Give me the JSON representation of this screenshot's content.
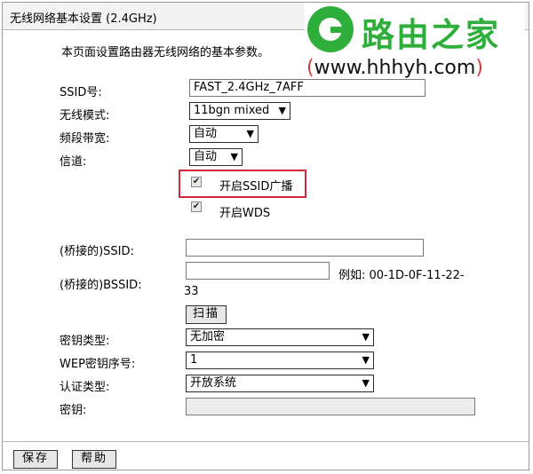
{
  "page": {
    "title": "无线网络基本设置 (2.4GHz)",
    "intro": "本页面设置路由器无线网络的基本参数。"
  },
  "watermark": {
    "name": "路由之家",
    "url_prefix": "(",
    "url": "www.hhhyh.com",
    "url_suffix": ")",
    "brand_color": "#2eae3a"
  },
  "form": {
    "ssid": {
      "label": "SSID号:",
      "value": "FAST_2.4GHz_7AFF"
    },
    "mode": {
      "label": "无线模式:",
      "value": "11bgn mixed"
    },
    "bandwidth": {
      "label": "频段带宽:",
      "value": "自动"
    },
    "channel": {
      "label": "信道:",
      "value": "自动"
    },
    "ssid_broadcast": {
      "label": "开启SSID广播",
      "checked": true
    },
    "wds": {
      "label": "开启WDS",
      "checked": true
    },
    "bridge_ssid": {
      "label": "(桥接的)SSID:",
      "value": ""
    },
    "bridge_bssid": {
      "label": "(桥接的)BSSID:",
      "value": "",
      "example": "例如: 00-1D-0F-11-22-",
      "example_cont": "33"
    },
    "scan_button": "扫描",
    "key_type": {
      "label": "密钥类型:",
      "value": "无加密"
    },
    "wep_index": {
      "label": "WEP密钥序号:",
      "value": "1"
    },
    "auth_type": {
      "label": "认证类型:",
      "value": "开放系统"
    },
    "key": {
      "label": "密钥:",
      "value": ""
    }
  },
  "footer": {
    "save": "保存",
    "help": "帮助"
  },
  "colors": {
    "highlight": "#d1283b"
  }
}
